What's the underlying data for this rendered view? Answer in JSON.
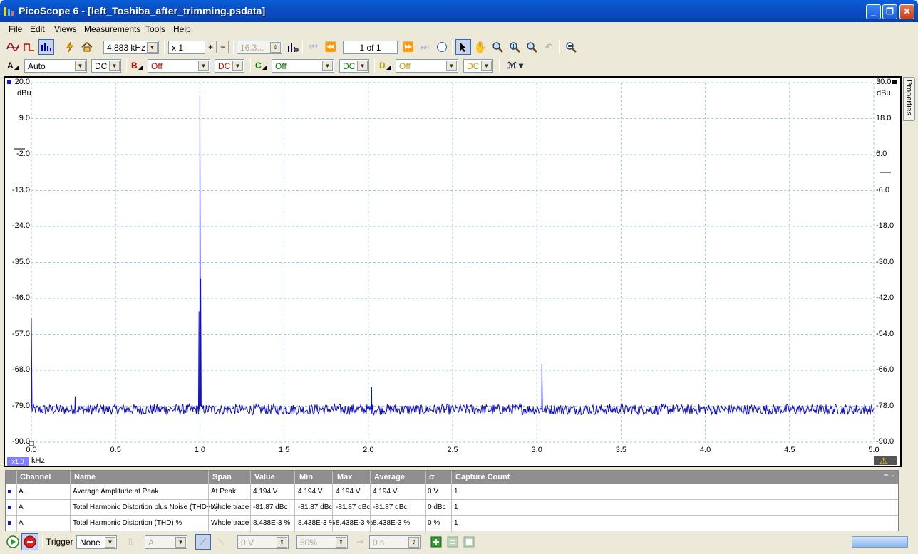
{
  "window": {
    "title": "PicoScope 6 - [left_Toshiba_after_trimming.psdata]"
  },
  "menu": [
    "File",
    "Edit",
    "Views",
    "Measurements",
    "Tools",
    "Help"
  ],
  "toolbar": {
    "span": "4.883 kHz",
    "zoom": "x 1",
    "samples": "16.3...",
    "page": "1 of 1"
  },
  "channels": {
    "a": {
      "letter": "A",
      "range": "Auto",
      "coupling": "DC",
      "color": "#0000c0"
    },
    "b": {
      "letter": "B",
      "range": "Off",
      "coupling": "DC",
      "color": "#d00000"
    },
    "c": {
      "letter": "C",
      "range": "Off",
      "coupling": "DC",
      "color": "#008000"
    },
    "d": {
      "letter": "D",
      "range": "Off",
      "coupling": "DC",
      "color": "#c0a000"
    }
  },
  "plot": {
    "left_unit": "dBu",
    "right_unit": "dBu",
    "x_unit": "kHz",
    "zoom_badge": "x1.0",
    "left_ticks": [
      "20.0",
      "9.0",
      "-2.0",
      "-13.0",
      "-24.0",
      "-35.0",
      "-46.0",
      "-57.0",
      "-68.0",
      "-79.0",
      "-90.0"
    ],
    "right_ticks": [
      "30.0",
      "18.0",
      "6.0",
      "-6.0",
      "-18.0",
      "-30.0",
      "-42.0",
      "-54.0",
      "-66.0",
      "-78.0",
      "-90.0"
    ],
    "x_ticks": [
      "0.0",
      "0.5",
      "1.0",
      "1.5",
      "2.0",
      "2.5",
      "3.0",
      "3.5",
      "4.0",
      "4.5",
      "5.0"
    ]
  },
  "chart_data": {
    "type": "line",
    "xlabel": "kHz",
    "ylabel": "dBu",
    "xlim": [
      0,
      5
    ],
    "ylim": [
      -90,
      20
    ],
    "grid": true,
    "series": [
      {
        "x": [
          0.0,
          0.01,
          0.25,
          0.26,
          0.98,
          0.995,
          1.0,
          1.005,
          1.02,
          1.04,
          2.0,
          2.01,
          2.02,
          2.9,
          3.0,
          3.02,
          3.03,
          4.0,
          5.0
        ],
        "y": [
          -52,
          -80,
          -80,
          -76,
          -79,
          -50,
          16,
          -40,
          -79,
          -80,
          -80,
          -80,
          -73,
          -78,
          -80,
          -80,
          -66,
          -80,
          -80
        ]
      }
    ]
  },
  "properties_tab": "Properties",
  "measurements": {
    "headers": [
      "Channel",
      "Name",
      "Span",
      "Value",
      "Min",
      "Max",
      "Average",
      "σ",
      "Capture Count"
    ],
    "rows": [
      [
        "A",
        "Average Amplitude at Peak",
        "At Peak",
        "4.194 V",
        "4.194 V",
        "4.194 V",
        "4.194 V",
        "0 V",
        "1"
      ],
      [
        "A",
        "Total Harmonic Distortion plus Noise (THD+N)",
        "Whole trace",
        "-81.87 dBc",
        "-81.87 dBc",
        "-81.87 dBc",
        "-81.87 dBc",
        "0 dBc",
        "1"
      ],
      [
        "A",
        "Total Harmonic Distortion (THD) %",
        "Whole trace",
        "8.438E-3 %",
        "8.438E-3 %",
        "8.438E-3 %",
        "8.438E-3 %",
        "0 %",
        "1"
      ]
    ]
  },
  "statusbar": {
    "trigger_label": "Trigger",
    "trigger_mode": "None",
    "trigger_source": "A",
    "threshold": "0 V",
    "pretrigger": "50%",
    "delay": "0 s"
  }
}
